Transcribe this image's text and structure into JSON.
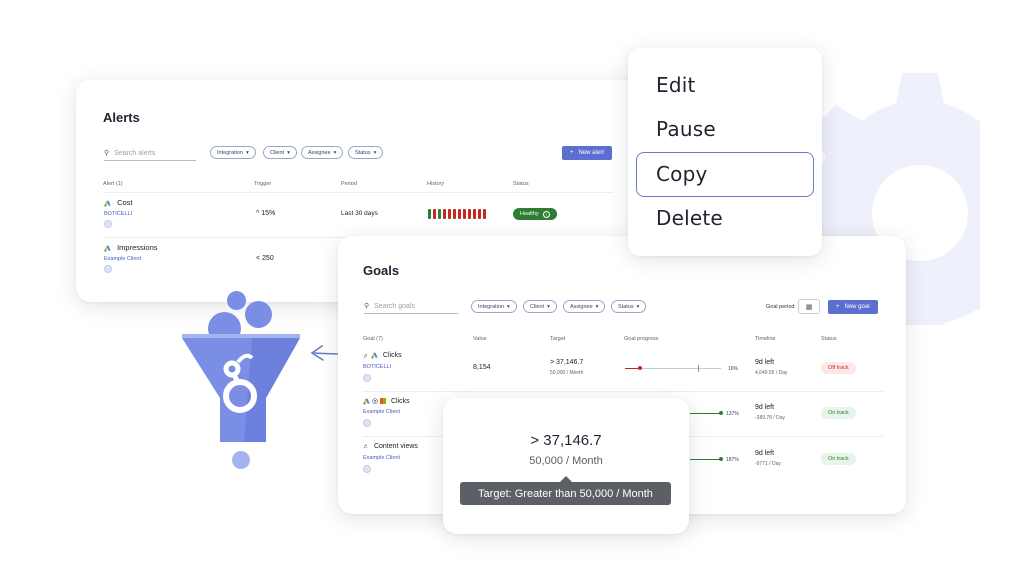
{
  "colors": {
    "accent": "#5b6fd0",
    "gear": "#eef0fb",
    "funnel": "#7b8ee6",
    "healthy_green": "#2e7d32",
    "bad_red": "#c62828",
    "off_track_bg": "#fde8e8",
    "on_track_bg": "#e7f4ea"
  },
  "alerts": {
    "title": "Alerts",
    "search_placeholder": "Search alerts",
    "filters": [
      "Integration",
      "Client",
      "Assignee",
      "Status"
    ],
    "new_button": "New alert",
    "columns": [
      "Alert (1)",
      "Trigger",
      "Period",
      "History",
      "Status"
    ],
    "rows": [
      {
        "name": "Cost",
        "client": "BOTICELLI",
        "trigger": "^ 15%",
        "period": "Last 30 days",
        "status": "Healthy",
        "history": [
          "g",
          "r",
          "g",
          "r",
          "r",
          "r",
          "r",
          "r",
          "r",
          "r",
          "r",
          "r"
        ],
        "icon": "google-ads-icon"
      },
      {
        "name": "Impressions",
        "client": "Example Client",
        "trigger": "< 250",
        "icon": "google-ads-icon"
      }
    ]
  },
  "goals": {
    "title": "Goals",
    "search_placeholder": "Search goals",
    "filters": [
      "Integration",
      "Client",
      "Assignee",
      "Status"
    ],
    "goal_period_label": "Goal period",
    "new_button": "New goal",
    "columns": [
      "Goal (7)",
      "Value",
      "Target",
      "Goal progress",
      "Timeline",
      "Status"
    ],
    "rows": [
      {
        "name": "Clicks",
        "client": "BOTICELLI",
        "value": "8,154",
        "target": "> 37,146.7",
        "target_sub": "50,000 / Month",
        "progress_pct": "16%",
        "progress": 0.16,
        "timeline": "9d left",
        "timeline_sub": "4,649.55 / Day",
        "status": "Off track"
      },
      {
        "name": "Clicks",
        "client": "Example Client",
        "progress_pct": "137%",
        "progress": 1.0,
        "timeline": "9d left",
        "timeline_sub": "-389.78 / Day",
        "status": "On track"
      },
      {
        "name": "Content views",
        "client": "Example Client",
        "progress_pct": "187%",
        "progress": 1.0,
        "timeline": "9d left",
        "timeline_sub": "-9771 / Day",
        "status": "On track"
      }
    ]
  },
  "menu": {
    "items": [
      "Edit",
      "Pause",
      "Copy",
      "Delete"
    ],
    "focused": "Copy"
  },
  "tooltip_card": {
    "value": "> 37,146.7",
    "sub": "50,000 / Month",
    "tooltip": "Target: Greater than 50,000 / Month"
  }
}
